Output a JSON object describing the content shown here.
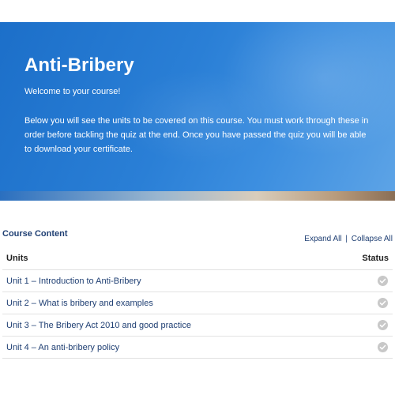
{
  "hero": {
    "title": "Anti-Bribery",
    "welcome": "Welcome to your course!",
    "description": "Below you will see the units to be covered on this course. You must work through these in order before tackling the quiz at the end. Once you have passed the quiz you will be able to download your certificate."
  },
  "content": {
    "heading": "Course Content",
    "expand_all": "Expand All",
    "separator": "|",
    "collapse_all": "Collapse All",
    "columns": {
      "units": "Units",
      "status": "Status"
    },
    "units": [
      {
        "label": "Unit 1 – Introduction to Anti-Bribery",
        "status_icon": "check-circle-icon",
        "status": "not completed"
      },
      {
        "label": "Unit 2 – What is bribery and examples",
        "status_icon": "check-circle-icon",
        "status": "not completed"
      },
      {
        "label": "Unit 3 – The Bribery Act 2010 and good practice",
        "status_icon": "check-circle-icon",
        "status": "not completed"
      },
      {
        "label": "Unit 4 – An anti-bribery policy",
        "status_icon": "check-circle-icon",
        "status": "not completed"
      }
    ]
  },
  "colors": {
    "hero_blue": "#2a7fd6",
    "heading_navy": "#1f3f73",
    "status_grey": "#c8c8c8"
  }
}
